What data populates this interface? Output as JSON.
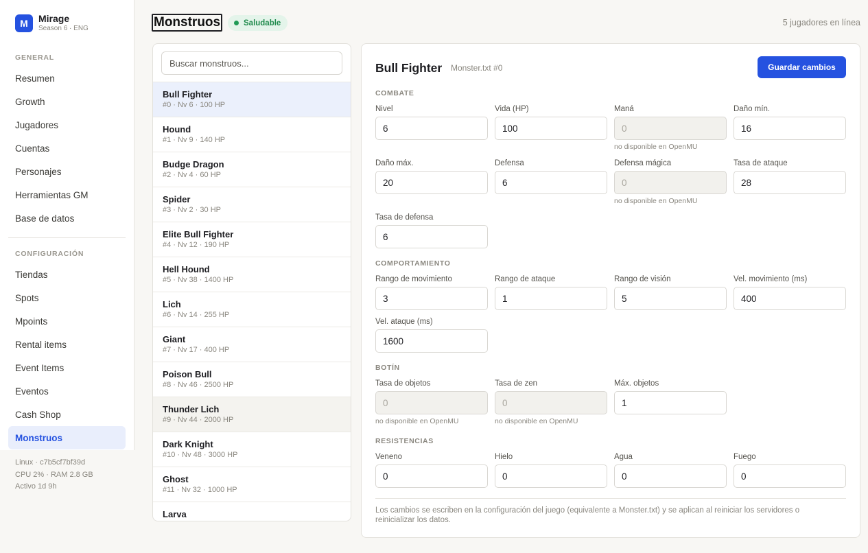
{
  "brand": {
    "initial": "M",
    "name": "Mirage",
    "subtitle": "Season 6 · ENG"
  },
  "sidebar": {
    "general_title": "GENERAL",
    "general_items": [
      {
        "label": "Resumen"
      },
      {
        "label": "Growth"
      },
      {
        "label": "Jugadores"
      },
      {
        "label": "Cuentas"
      },
      {
        "label": "Personajes"
      },
      {
        "label": "Herramientas GM"
      },
      {
        "label": "Base de datos"
      }
    ],
    "config_title": "CONFIGURACIÓN",
    "config_items": [
      {
        "label": "Tiendas"
      },
      {
        "label": "Spots"
      },
      {
        "label": "Mpoints"
      },
      {
        "label": "Rental items"
      },
      {
        "label": "Event Items"
      },
      {
        "label": "Eventos"
      },
      {
        "label": "Cash Shop"
      },
      {
        "label": "Monstruos"
      }
    ],
    "system": {
      "host": "Linux · c7b5cf7bf39d",
      "resources": "CPU 2% · RAM 2.8 GB",
      "uptime": "Activo 1d 9h"
    }
  },
  "header": {
    "title": "Monstruos",
    "status": "Saludable",
    "online": "5 jugadores en línea"
  },
  "search": {
    "placeholder": "Buscar monstruos..."
  },
  "monsters": [
    {
      "name": "Bull Fighter",
      "meta": "#0 · Nv 6 · 100 HP"
    },
    {
      "name": "Hound",
      "meta": "#1 · Nv 9 · 140 HP"
    },
    {
      "name": "Budge Dragon",
      "meta": "#2 · Nv 4 · 60 HP"
    },
    {
      "name": "Spider",
      "meta": "#3 · Nv 2 · 30 HP"
    },
    {
      "name": "Elite Bull Fighter",
      "meta": "#4 · Nv 12 · 190 HP"
    },
    {
      "name": "Hell Hound",
      "meta": "#5 · Nv 38 · 1400 HP"
    },
    {
      "name": "Lich",
      "meta": "#6 · Nv 14 · 255 HP"
    },
    {
      "name": "Giant",
      "meta": "#7 · Nv 17 · 400 HP"
    },
    {
      "name": "Poison Bull",
      "meta": "#8 · Nv 46 · 2500 HP"
    },
    {
      "name": "Thunder Lich",
      "meta": "#9 · Nv 44 · 2000 HP"
    },
    {
      "name": "Dark Knight",
      "meta": "#10 · Nv 48 · 3000 HP"
    },
    {
      "name": "Ghost",
      "meta": "#11 · Nv 32 · 1000 HP"
    },
    {
      "name": "Larva",
      "meta": ""
    }
  ],
  "editor": {
    "title": "Bull Fighter",
    "subtitle": "Monster.txt #0",
    "save_label": "Guardar cambios",
    "unavailable_note": "no disponible en OpenMU",
    "sections": {
      "combat": "COMBATE",
      "behavior": "COMPORTAMIENTO",
      "loot": "BOTÍN",
      "resist": "RESISTENCIAS"
    },
    "fields": {
      "level": {
        "label": "Nivel",
        "value": "6"
      },
      "hp": {
        "label": "Vida (HP)",
        "value": "100"
      },
      "mana": {
        "label": "Maná",
        "value": "0"
      },
      "dmg_min": {
        "label": "Daño mín.",
        "value": "16"
      },
      "dmg_max": {
        "label": "Daño máx.",
        "value": "20"
      },
      "defense": {
        "label": "Defensa",
        "value": "6"
      },
      "magic_defense": {
        "label": "Defensa mágica",
        "value": "0"
      },
      "attack_rate": {
        "label": "Tasa de ataque",
        "value": "28"
      },
      "defense_rate": {
        "label": "Tasa de defensa",
        "value": "6"
      },
      "move_range": {
        "label": "Rango de movimiento",
        "value": "3"
      },
      "attack_range": {
        "label": "Rango de ataque",
        "value": "1"
      },
      "view_range": {
        "label": "Rango de visión",
        "value": "5"
      },
      "move_speed": {
        "label": "Vel. movimiento (ms)",
        "value": "400"
      },
      "attack_speed": {
        "label": "Vel. ataque (ms)",
        "value": "1600"
      },
      "item_rate": {
        "label": "Tasa de objetos",
        "value": "0"
      },
      "zen_rate": {
        "label": "Tasa de zen",
        "value": "0"
      },
      "max_items": {
        "label": "Máx. objetos",
        "value": "1"
      },
      "poison": {
        "label": "Veneno",
        "value": "0"
      },
      "ice": {
        "label": "Hielo",
        "value": "0"
      },
      "water": {
        "label": "Agua",
        "value": "0"
      },
      "fire": {
        "label": "Fuego",
        "value": "0"
      }
    },
    "footer": "Los cambios se escriben en la configuración del juego (equivalente a Monster.txt) y se aplican al reiniciar los servidores o reinicializar los datos."
  }
}
